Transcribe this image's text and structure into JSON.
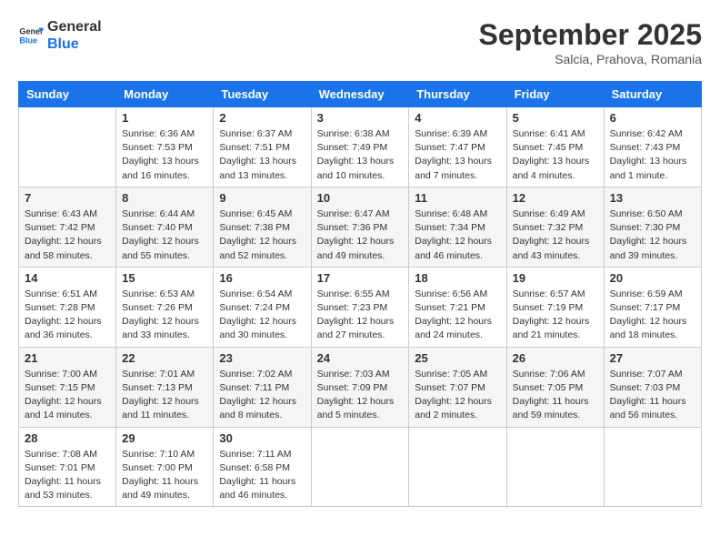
{
  "logo": {
    "line1": "General",
    "line2": "Blue"
  },
  "title": "September 2025",
  "location": "Salcia, Prahova, Romania",
  "days_of_week": [
    "Sunday",
    "Monday",
    "Tuesday",
    "Wednesday",
    "Thursday",
    "Friday",
    "Saturday"
  ],
  "weeks": [
    [
      {
        "day": "",
        "info": ""
      },
      {
        "day": "1",
        "info": "Sunrise: 6:36 AM\nSunset: 7:53 PM\nDaylight: 13 hours\nand 16 minutes."
      },
      {
        "day": "2",
        "info": "Sunrise: 6:37 AM\nSunset: 7:51 PM\nDaylight: 13 hours\nand 13 minutes."
      },
      {
        "day": "3",
        "info": "Sunrise: 6:38 AM\nSunset: 7:49 PM\nDaylight: 13 hours\nand 10 minutes."
      },
      {
        "day": "4",
        "info": "Sunrise: 6:39 AM\nSunset: 7:47 PM\nDaylight: 13 hours\nand 7 minutes."
      },
      {
        "day": "5",
        "info": "Sunrise: 6:41 AM\nSunset: 7:45 PM\nDaylight: 13 hours\nand 4 minutes."
      },
      {
        "day": "6",
        "info": "Sunrise: 6:42 AM\nSunset: 7:43 PM\nDaylight: 13 hours\nand 1 minute."
      }
    ],
    [
      {
        "day": "7",
        "info": "Sunrise: 6:43 AM\nSunset: 7:42 PM\nDaylight: 12 hours\nand 58 minutes."
      },
      {
        "day": "8",
        "info": "Sunrise: 6:44 AM\nSunset: 7:40 PM\nDaylight: 12 hours\nand 55 minutes."
      },
      {
        "day": "9",
        "info": "Sunrise: 6:45 AM\nSunset: 7:38 PM\nDaylight: 12 hours\nand 52 minutes."
      },
      {
        "day": "10",
        "info": "Sunrise: 6:47 AM\nSunset: 7:36 PM\nDaylight: 12 hours\nand 49 minutes."
      },
      {
        "day": "11",
        "info": "Sunrise: 6:48 AM\nSunset: 7:34 PM\nDaylight: 12 hours\nand 46 minutes."
      },
      {
        "day": "12",
        "info": "Sunrise: 6:49 AM\nSunset: 7:32 PM\nDaylight: 12 hours\nand 43 minutes."
      },
      {
        "day": "13",
        "info": "Sunrise: 6:50 AM\nSunset: 7:30 PM\nDaylight: 12 hours\nand 39 minutes."
      }
    ],
    [
      {
        "day": "14",
        "info": "Sunrise: 6:51 AM\nSunset: 7:28 PM\nDaylight: 12 hours\nand 36 minutes."
      },
      {
        "day": "15",
        "info": "Sunrise: 6:53 AM\nSunset: 7:26 PM\nDaylight: 12 hours\nand 33 minutes."
      },
      {
        "day": "16",
        "info": "Sunrise: 6:54 AM\nSunset: 7:24 PM\nDaylight: 12 hours\nand 30 minutes."
      },
      {
        "day": "17",
        "info": "Sunrise: 6:55 AM\nSunset: 7:23 PM\nDaylight: 12 hours\nand 27 minutes."
      },
      {
        "day": "18",
        "info": "Sunrise: 6:56 AM\nSunset: 7:21 PM\nDaylight: 12 hours\nand 24 minutes."
      },
      {
        "day": "19",
        "info": "Sunrise: 6:57 AM\nSunset: 7:19 PM\nDaylight: 12 hours\nand 21 minutes."
      },
      {
        "day": "20",
        "info": "Sunrise: 6:59 AM\nSunset: 7:17 PM\nDaylight: 12 hours\nand 18 minutes."
      }
    ],
    [
      {
        "day": "21",
        "info": "Sunrise: 7:00 AM\nSunset: 7:15 PM\nDaylight: 12 hours\nand 14 minutes."
      },
      {
        "day": "22",
        "info": "Sunrise: 7:01 AM\nSunset: 7:13 PM\nDaylight: 12 hours\nand 11 minutes."
      },
      {
        "day": "23",
        "info": "Sunrise: 7:02 AM\nSunset: 7:11 PM\nDaylight: 12 hours\nand 8 minutes."
      },
      {
        "day": "24",
        "info": "Sunrise: 7:03 AM\nSunset: 7:09 PM\nDaylight: 12 hours\nand 5 minutes."
      },
      {
        "day": "25",
        "info": "Sunrise: 7:05 AM\nSunset: 7:07 PM\nDaylight: 12 hours\nand 2 minutes."
      },
      {
        "day": "26",
        "info": "Sunrise: 7:06 AM\nSunset: 7:05 PM\nDaylight: 11 hours\nand 59 minutes."
      },
      {
        "day": "27",
        "info": "Sunrise: 7:07 AM\nSunset: 7:03 PM\nDaylight: 11 hours\nand 56 minutes."
      }
    ],
    [
      {
        "day": "28",
        "info": "Sunrise: 7:08 AM\nSunset: 7:01 PM\nDaylight: 11 hours\nand 53 minutes."
      },
      {
        "day": "29",
        "info": "Sunrise: 7:10 AM\nSunset: 7:00 PM\nDaylight: 11 hours\nand 49 minutes."
      },
      {
        "day": "30",
        "info": "Sunrise: 7:11 AM\nSunset: 6:58 PM\nDaylight: 11 hours\nand 46 minutes."
      },
      {
        "day": "",
        "info": ""
      },
      {
        "day": "",
        "info": ""
      },
      {
        "day": "",
        "info": ""
      },
      {
        "day": "",
        "info": ""
      }
    ]
  ]
}
